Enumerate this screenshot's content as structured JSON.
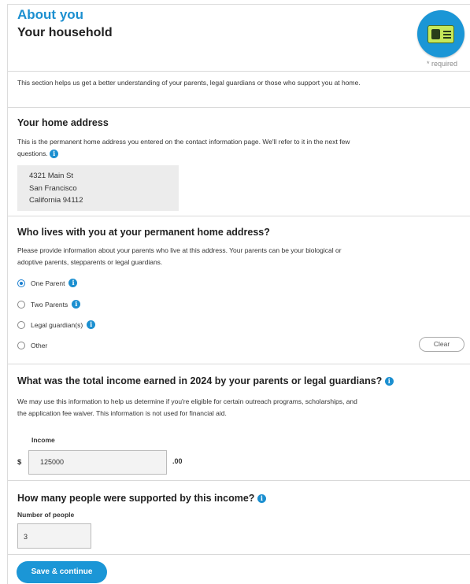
{
  "header": {
    "section_label": "About you",
    "page_title": "Your household",
    "required_note": "* required",
    "badge_icon": "id-card-icon"
  },
  "intro": "This section helps us get a better understanding of your parents, legal guardians or those who support you at home.",
  "home_address": {
    "heading": "Your home address",
    "description": "This is the permanent home address you entered on the contact information page. We'll refer to it in the next few questions.",
    "info_icon": "i",
    "lines": [
      "4321 Main St",
      "San Francisco",
      "California 94112"
    ]
  },
  "who_lives": {
    "heading": "Who lives with you at your permanent home address?",
    "description": "Please provide information about your parents who live at this address. Your parents can be your biological or adoptive parents, stepparents or legal guardians.",
    "options": [
      {
        "label": "One Parent",
        "checked": true,
        "has_info": true
      },
      {
        "label": "Two Parents",
        "checked": false,
        "has_info": true
      },
      {
        "label": "Legal guardian(s)",
        "checked": false,
        "has_info": true
      },
      {
        "label": "Other",
        "checked": false,
        "has_info": false
      }
    ],
    "clear_label": "Clear"
  },
  "income": {
    "heading": "What was the total income earned in 2024 by your parents or legal guardians?",
    "description": "We may use this information to help us determine if you're eligible for certain outreach programs, scholarships, and the application fee waiver. This information is not used for financial aid.",
    "field_label": "Income",
    "currency_symbol": "$",
    "value": "125000",
    "cents": ".00"
  },
  "people": {
    "heading": "How many people were supported by this income?",
    "field_label": "Number of people",
    "value": "3"
  },
  "actions": {
    "save_label": "Save & continue"
  },
  "colors": {
    "accent": "#1b8fd0",
    "button": "#1b96d6",
    "badge_card": "#c6e85a"
  }
}
